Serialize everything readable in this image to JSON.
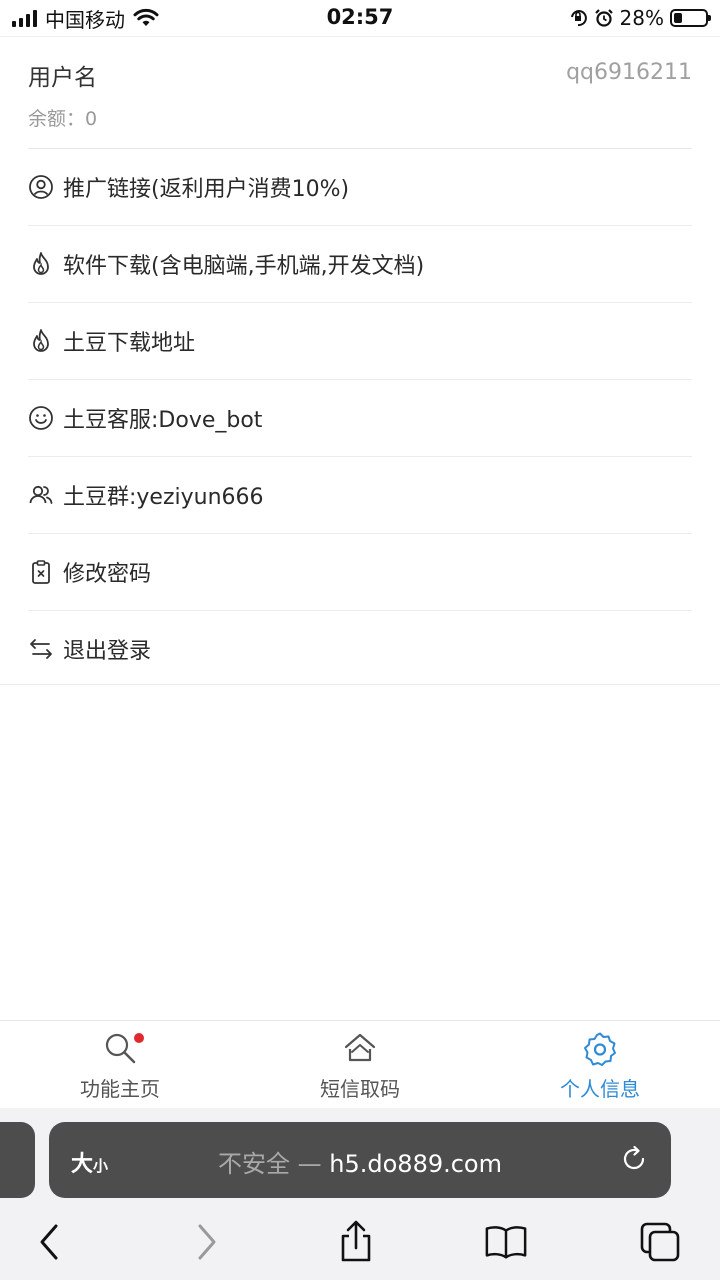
{
  "status_bar": {
    "carrier": "中国移动",
    "time": "02:57",
    "battery_percent": "28%",
    "battery_level": 0.28
  },
  "user": {
    "username_label": "用户名",
    "username": "qq6916211",
    "balance": "余额：0"
  },
  "menu": [
    {
      "label": "推广链接(返利用户消费10%)",
      "icon": "user-circle-icon"
    },
    {
      "label": "软件下载(含电脑端,手机端,开发文档)",
      "icon": "fire-icon"
    },
    {
      "label": "土豆下载地址",
      "icon": "fire-icon"
    },
    {
      "label": "土豆客服:Dove_bot",
      "icon": "smile-icon"
    },
    {
      "label": "土豆群:yeziyun666",
      "icon": "users-icon"
    },
    {
      "label": "修改密码",
      "icon": "clipboard-x-icon"
    },
    {
      "label": "退出登录",
      "icon": "swap-arrows-icon"
    }
  ],
  "tabbar": {
    "tabs": [
      {
        "label": "功能主页",
        "icon": "search-icon",
        "active": false,
        "badge": true
      },
      {
        "label": "短信取码",
        "icon": "home-icon",
        "active": false
      },
      {
        "label": "个人信息",
        "icon": "gear-icon",
        "active": true
      }
    ],
    "active_color": "#2f8ad6"
  },
  "browser": {
    "text_size_big": "大",
    "text_size_small": "小",
    "insecure_label": "不安全 —",
    "url": "h5.do889.com"
  }
}
